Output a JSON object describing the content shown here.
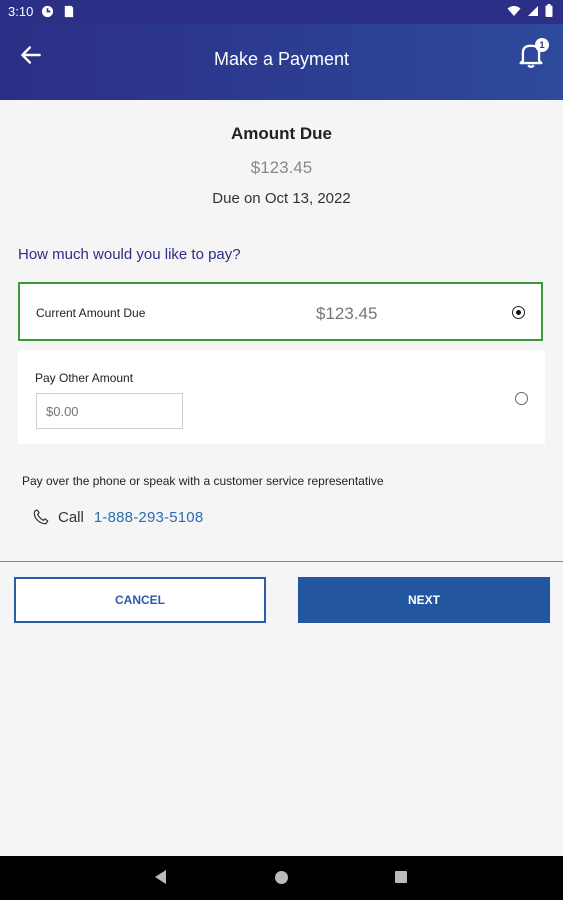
{
  "status_bar": {
    "time": "3:10"
  },
  "app_bar": {
    "title": "Make a Payment",
    "notification_count": "1"
  },
  "summary": {
    "heading": "Amount Due",
    "amount": "$123.45",
    "due_date": "Due on Oct 13, 2022"
  },
  "question": "How much would you like to pay?",
  "options": {
    "current": {
      "label": "Current Amount Due",
      "amount": "$123.45",
      "selected": true
    },
    "other": {
      "label": "Pay Other Amount",
      "placeholder": "$0.00",
      "selected": false
    }
  },
  "contact": {
    "text": "Pay over the phone or speak with a customer service representative",
    "call_label": "Call",
    "phone": "1-888-293-5108"
  },
  "buttons": {
    "cancel": "CANCEL",
    "next": "NEXT"
  },
  "colors": {
    "header": "#2c2e85",
    "accent": "#22579f",
    "selected_border": "#3a9a3a",
    "link": "#2a6db1"
  },
  "icons": [
    "back-arrow-icon",
    "bell-icon",
    "phone-icon"
  ]
}
